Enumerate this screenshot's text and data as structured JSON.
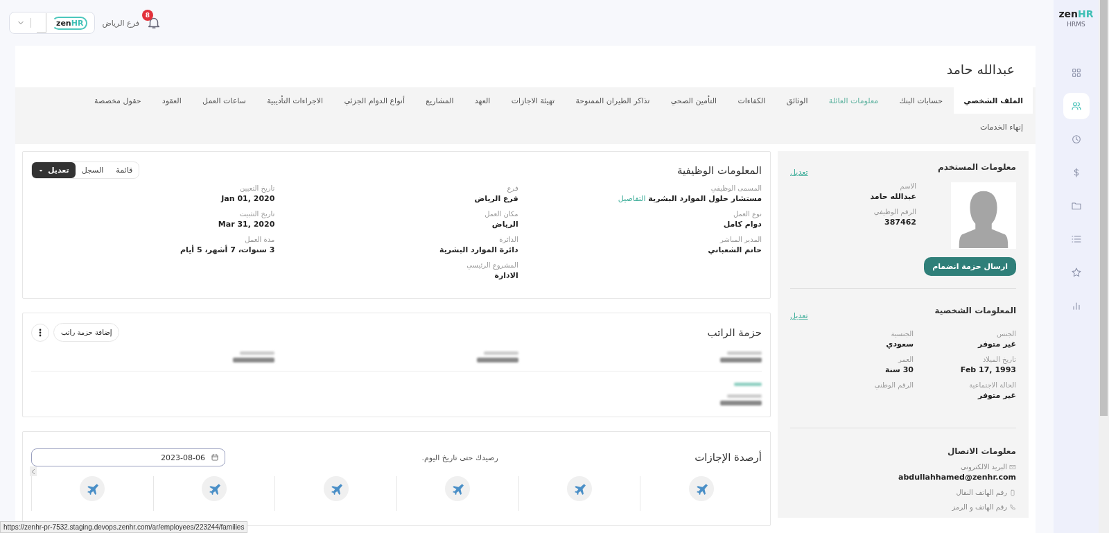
{
  "top_bar": {
    "company_logo": {
      "main": "zen",
      "accent": "HR"
    },
    "branch": "فرع الرياض",
    "notifications": "8"
  },
  "brand": {
    "main": "zen",
    "accent": "HR",
    "subtitle": "HRMS"
  },
  "nav": [
    {
      "kind": "grid",
      "selected": false
    },
    {
      "kind": "people",
      "selected": true
    },
    {
      "kind": "clock",
      "selected": false
    },
    {
      "kind": "dollar",
      "selected": false
    },
    {
      "kind": "folder",
      "selected": false
    },
    {
      "kind": "list",
      "selected": false
    },
    {
      "kind": "star",
      "selected": false
    },
    {
      "kind": "chart",
      "selected": false
    }
  ],
  "employee_name": "عبدالله حامد",
  "tab_rows": [
    [
      {
        "label": "الملف الشخصي",
        "selected": true,
        "hovered": false
      },
      {
        "label": "حسابات البنك",
        "selected": false,
        "hovered": false
      },
      {
        "label": "معلومات العائلة",
        "selected": false,
        "hovered": true
      },
      {
        "label": "الوثائق",
        "selected": false,
        "hovered": false
      },
      {
        "label": "الكفاءات",
        "selected": false,
        "hovered": false
      },
      {
        "label": "التأمين الصحي",
        "selected": false,
        "hovered": false
      },
      {
        "label": "تذاكر الطيران الممنوحة",
        "selected": false,
        "hovered": false
      },
      {
        "label": "تهيئة الاجازات",
        "selected": false,
        "hovered": false
      },
      {
        "label": "العهد",
        "selected": false,
        "hovered": false
      },
      {
        "label": "المشاريع",
        "selected": false,
        "hovered": false
      },
      {
        "label": "أنواع الدوام الجزئي",
        "selected": false,
        "hovered": false
      },
      {
        "label": "الاجراءات التأديبية",
        "selected": false,
        "hovered": false
      },
      {
        "label": "ساعات العمل",
        "selected": false,
        "hovered": false
      },
      {
        "label": "العقود",
        "selected": false,
        "hovered": false
      },
      {
        "label": "حقول مخصصة",
        "selected": false,
        "hovered": false
      }
    ],
    [
      {
        "label": "إنهاء الخدمات",
        "selected": false,
        "hovered": false
      }
    ]
  ],
  "job_info": {
    "title": "المعلومات الوظيفية",
    "view_buttons": [
      {
        "label": "قائمة",
        "kind": "plain"
      },
      {
        "label": "السجل",
        "kind": "plain"
      },
      {
        "label": "تعديل",
        "kind": "dropdown"
      }
    ],
    "columns": [
      [
        {
          "label": "المسمى الوظيفي",
          "value": "مستشار حلول الموارد البشرية",
          "link": "التفاصيل"
        },
        {
          "label": "نوع العمل",
          "value": "دوام كامل"
        },
        {
          "label": "المدير المباشر",
          "value": "حاتم الشعباني"
        }
      ],
      [
        {
          "label": "فرع",
          "value": "فرع الرياض"
        },
        {
          "label": "مكان العمل",
          "value": "الرياض"
        },
        {
          "label": "الدائرة",
          "value": "دائرة الموارد البشرية"
        },
        {
          "label": "المشروع الرئيسي",
          "value": "الادارة"
        }
      ],
      [
        {
          "label": "تاريخ التعيين",
          "value": "Jan 01, 2020"
        },
        {
          "label": "تاريخ التثبيت",
          "value": "Mar 31, 2020"
        },
        {
          "label": "مدة العمل",
          "value": "3 سنوات، 7 أشهر، 5 أيام"
        }
      ]
    ]
  },
  "salary": {
    "title": "حزمة الراتب",
    "add_button": "إضافة حزمة راتب"
  },
  "leaves": {
    "title": "أرصدة الإجازات",
    "note": "رصيدك حتى تاريخ اليوم.",
    "date": "2023-08-06",
    "balances": [
      {
        "kind": "plane"
      },
      {
        "kind": "plane"
      },
      {
        "kind": "plane"
      },
      {
        "kind": "plane"
      },
      {
        "kind": "plane"
      },
      {
        "kind": "plane"
      }
    ]
  },
  "user_info": {
    "title": "معلومات المستخدم",
    "edit": "تعديل",
    "fields": [
      {
        "label": "الاسم",
        "value": "عبدالله حامد"
      },
      {
        "label": "الرقم الوظيفي",
        "value": "387462"
      }
    ],
    "button": "ارسال حزمة انضمام"
  },
  "personal_info": {
    "title": "المعلومات الشخصية",
    "edit": "تعديل",
    "fields": [
      {
        "label": "الجنس",
        "value": "غير متوفر"
      },
      {
        "label": "الجنسية",
        "value": "سعودي"
      },
      {
        "label": "تاريخ الميلاد",
        "value": "Feb 17, 1993"
      },
      {
        "label": "العمر",
        "value": "30 سنة"
      },
      {
        "label": "الحالة الاجتماعية",
        "value": "غير متوفر"
      },
      {
        "label": "الرقم الوطني"
      }
    ]
  },
  "contact_info": {
    "title": "معلومات الاتصال",
    "items": [
      {
        "kind": "email",
        "label": "البريد الالكتروني",
        "value": "abdullahhamed@zenhr.com"
      },
      {
        "kind": "mobile",
        "label": "رقم الهاتف النقال"
      },
      {
        "kind": "phone",
        "label": "رقم الهاتف و الرمز"
      }
    ]
  },
  "status_url": "https://zenhr-pr-7532.staging.devops.zenhr.com/ar/employees/223244/families"
}
